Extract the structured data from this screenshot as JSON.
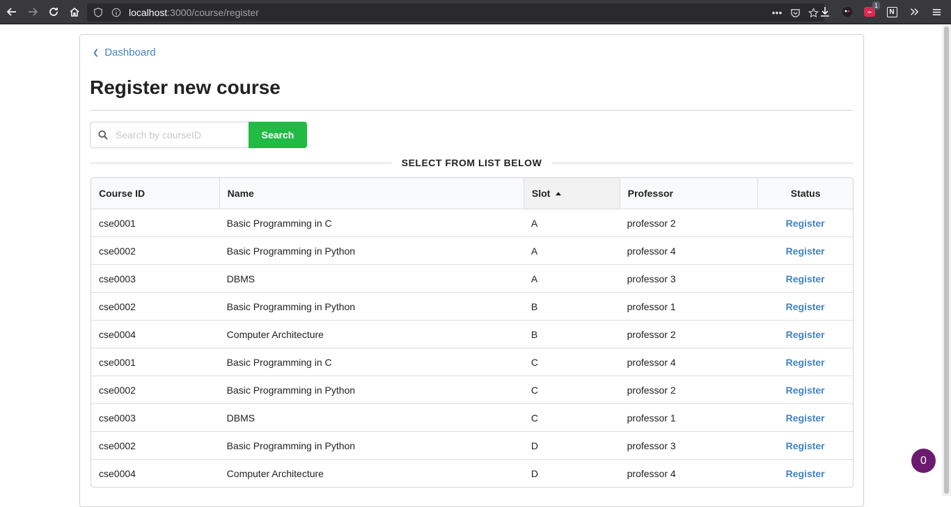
{
  "browser": {
    "url_host": "localhost",
    "url_path": ":3000/course/register",
    "extension_badge": "1",
    "extension_label": "••"
  },
  "page": {
    "back_link": "Dashboard",
    "title": "Register new course",
    "search_placeholder": "Search by courseID",
    "search_button": "Search",
    "section_label": "SELECT FROM LIST BELOW"
  },
  "table": {
    "headers": [
      "Course ID",
      "Name",
      "Slot",
      "Professor",
      "Status"
    ],
    "sorted_column": "Slot",
    "sort_direction": "ascending",
    "rows": [
      {
        "id": "cse0001",
        "name": "Basic Programming in C",
        "slot": "A",
        "professor": "professor 2",
        "status": "Register"
      },
      {
        "id": "cse0002",
        "name": "Basic Programming in Python",
        "slot": "A",
        "professor": "professor 4",
        "status": "Register"
      },
      {
        "id": "cse0003",
        "name": "DBMS",
        "slot": "A",
        "professor": "professor 3",
        "status": "Register"
      },
      {
        "id": "cse0002",
        "name": "Basic Programming in Python",
        "slot": "B",
        "professor": "professor 1",
        "status": "Register"
      },
      {
        "id": "cse0004",
        "name": "Computer Architecture",
        "slot": "B",
        "professor": "professor 2",
        "status": "Register"
      },
      {
        "id": "cse0001",
        "name": "Basic Programming in C",
        "slot": "C",
        "professor": "professor 4",
        "status": "Register"
      },
      {
        "id": "cse0002",
        "name": "Basic Programming in Python",
        "slot": "C",
        "professor": "professor 2",
        "status": "Register"
      },
      {
        "id": "cse0003",
        "name": "DBMS",
        "slot": "C",
        "professor": "professor 1",
        "status": "Register"
      },
      {
        "id": "cse0002",
        "name": "Basic Programming in Python",
        "slot": "D",
        "professor": "professor 3",
        "status": "Register"
      },
      {
        "id": "cse0004",
        "name": "Computer Architecture",
        "slot": "D",
        "professor": "professor 4",
        "status": "Register"
      }
    ]
  },
  "floating_button": {
    "label": "0"
  },
  "colors": {
    "accent_link": "#4183c4",
    "search_button": "#21ba45",
    "fab": "#6b1b6f"
  }
}
